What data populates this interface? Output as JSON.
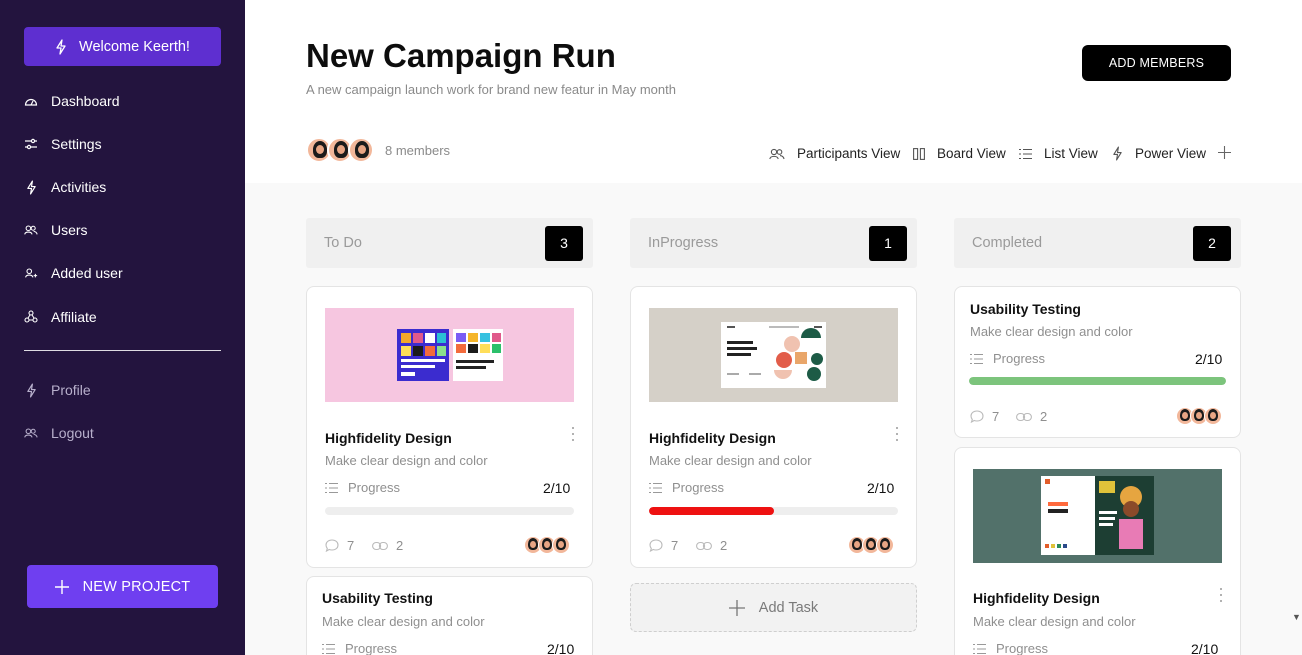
{
  "sidebar": {
    "welcome": "Welcome Keerth!",
    "items": [
      {
        "label": "Dashboard",
        "icon": "dashboard-icon"
      },
      {
        "label": "Settings",
        "icon": "sliders-icon"
      },
      {
        "label": "Activities",
        "icon": "bolt-icon"
      },
      {
        "label": "Users",
        "icon": "users-icon"
      },
      {
        "label": "Added user",
        "icon": "add-user-icon"
      },
      {
        "label": "Affiliate",
        "icon": "affiliate-icon"
      }
    ],
    "secondary": [
      {
        "label": "Profile",
        "icon": "bolt-icon"
      },
      {
        "label": "Logout",
        "icon": "users-icon"
      }
    ],
    "new_project": "NEW PROJECT"
  },
  "header": {
    "title": "New Campaign Run",
    "subtitle": "A new campaign launch work for brand new featur in May month",
    "add_members": "ADD MEMBERS",
    "members_count": "8 members",
    "views": [
      "Participants View",
      "Board View",
      "List View",
      "Power View"
    ]
  },
  "columns": [
    {
      "label": "To Do",
      "count": "3"
    },
    {
      "label": "InProgress",
      "count": "1"
    },
    {
      "label": "Completed",
      "count": "2"
    }
  ],
  "cards": {
    "todo_1": {
      "title": "Highfidelity Design",
      "desc": "Make clear design and color",
      "progress_label": "Progress",
      "progress": "2/10",
      "progress_fill": 0,
      "comments": "7",
      "links": "2"
    },
    "todo_2": {
      "title": "Usability Testing",
      "desc": "Make clear design and color",
      "progress_label": "Progress",
      "progress": "2/10"
    },
    "inprog_1": {
      "title": "Highfidelity Design",
      "desc": "Make clear design and color",
      "progress_label": "Progress",
      "progress": "2/10",
      "progress_fill": 0.5,
      "bar_color": "#ee1111",
      "comments": "7",
      "links": "2"
    },
    "done_1": {
      "title": "Usability Testing",
      "desc": "Make clear design and color",
      "progress_label": "Progress",
      "progress": "2/10",
      "progress_fill": 1,
      "bar_color": "#7cc47c",
      "comments": "7",
      "links": "2"
    },
    "done_2": {
      "title": "Highfidelity Design",
      "desc": "Make clear design and color",
      "progress_label": "Progress",
      "progress": "2/10"
    }
  },
  "add_task": "Add Task",
  "colors": {
    "sidebar": "#23143e",
    "accent": "#6f3ff0",
    "welcome": "#5e2fd0"
  }
}
